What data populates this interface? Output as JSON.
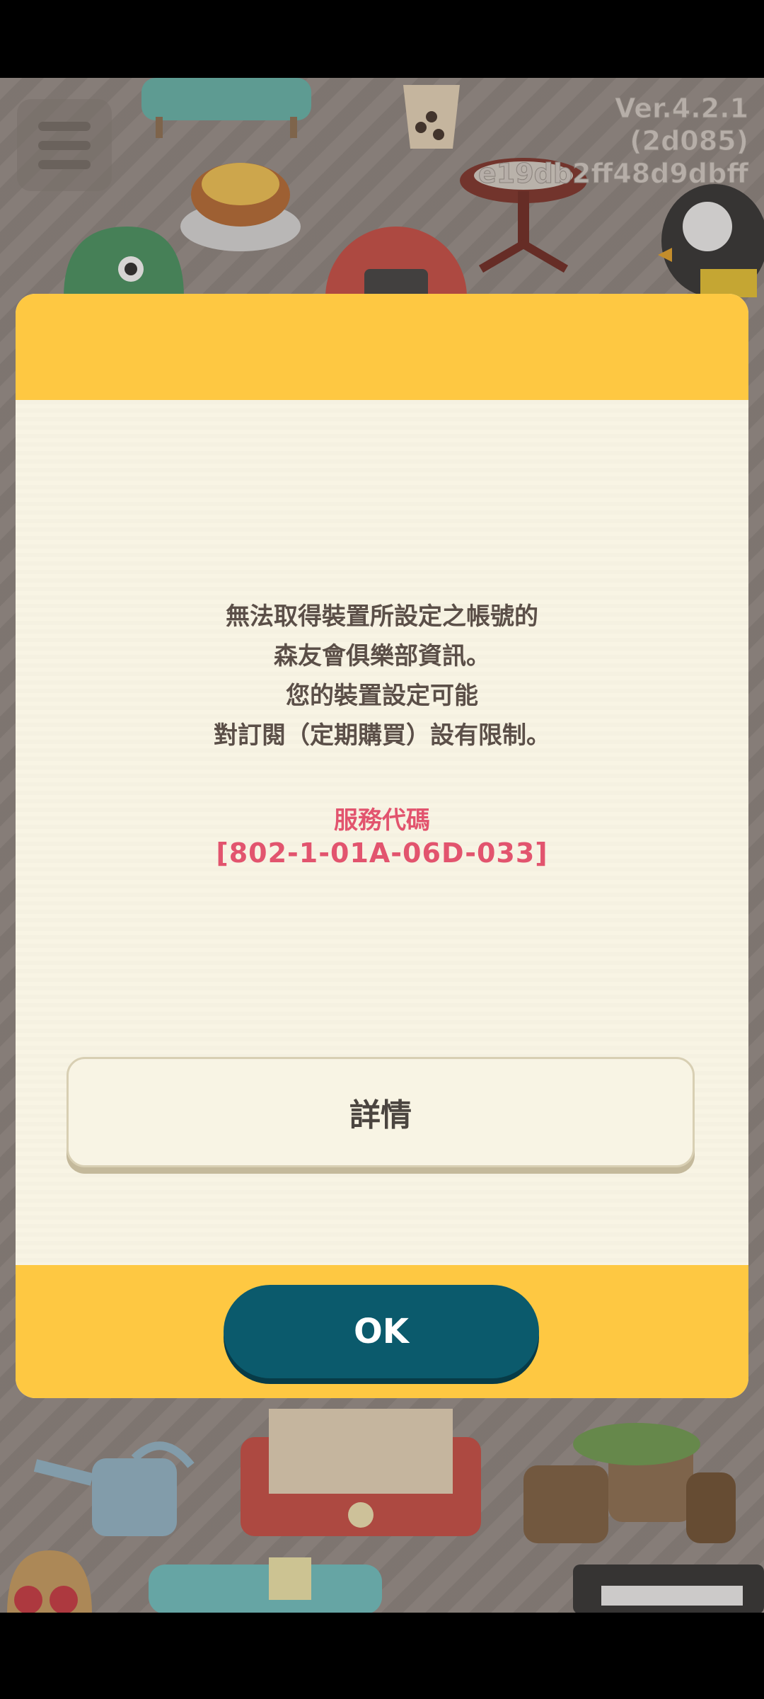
{
  "app": {
    "version_lines": [
      "Ver.4.2.1",
      "(2d085)",
      "e19db2ff48d9dbff"
    ]
  },
  "menu": {
    "icon": "hamburger-menu-icon"
  },
  "dialog": {
    "message_lines": [
      "無法取得裝置所設定之帳號的",
      "森友會俱樂部資訊。",
      "您的裝置設定可能",
      "對訂閱（定期購買）設有限制。"
    ],
    "service_code_label": "服務代碼",
    "service_code": "[802-1-01A-06D-033]",
    "details_label": "詳情",
    "ok_label": "OK",
    "colors": {
      "header": "#fec842",
      "body": "#f8f4e4",
      "code": "#e2546e",
      "ok_button": "#0b5a6c"
    }
  }
}
